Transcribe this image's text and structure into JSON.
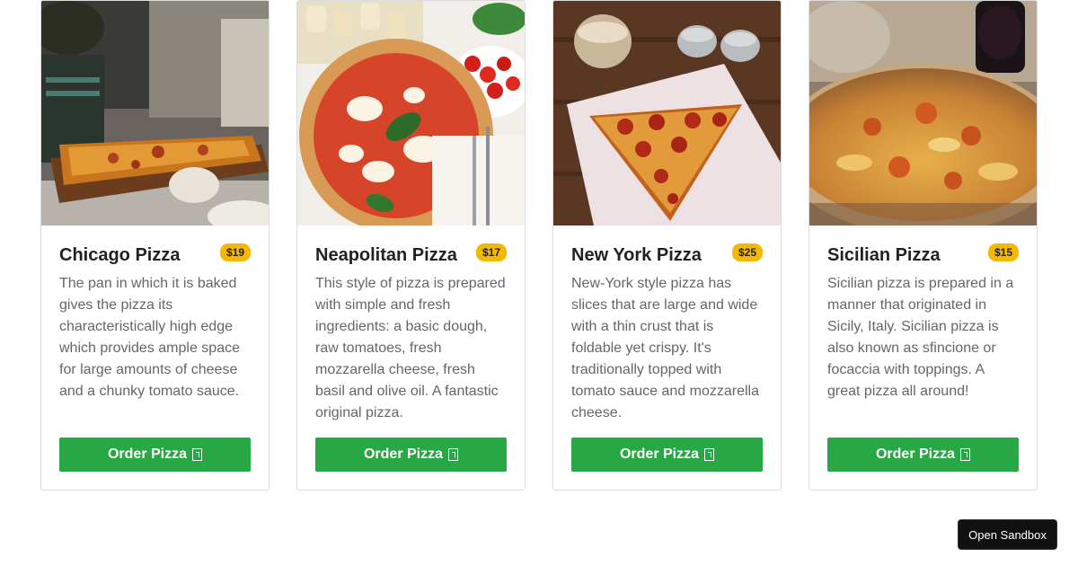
{
  "cards": [
    {
      "title": "Chicago Pizza",
      "price": "$19",
      "description": "The pan in which it is baked gives the pizza its characteristically high edge which provides ample space for large amounts of cheese and a chunky tomato sauce.",
      "button_label": "Order Pizza"
    },
    {
      "title": "Neapolitan Pizza",
      "price": "$17",
      "description": "This style of pizza is prepared with simple and fresh ingredients: a basic dough, raw tomatoes, fresh mozzarella cheese, fresh basil and olive oil. A fantastic original pizza.",
      "button_label": "Order Pizza"
    },
    {
      "title": "New York Pizza",
      "price": "$25",
      "description": "New-York style pizza has slices that are large and wide with a thin crust that is foldable yet crispy. It's traditionally topped with tomato sauce and mozzarella cheese.",
      "button_label": "Order Pizza"
    },
    {
      "title": "Sicilian Pizza",
      "price": "$15",
      "description": "Sicilian pizza is prepared in a manner that originated in Sicily, Italy. Sicilian pizza is also known as sfincione or focaccia with toppings. A great pizza all around!",
      "button_label": "Order Pizza"
    }
  ],
  "sandbox_button": "Open Sandbox",
  "colors": {
    "button_green": "#28a745",
    "price_badge": "#f5b800"
  }
}
